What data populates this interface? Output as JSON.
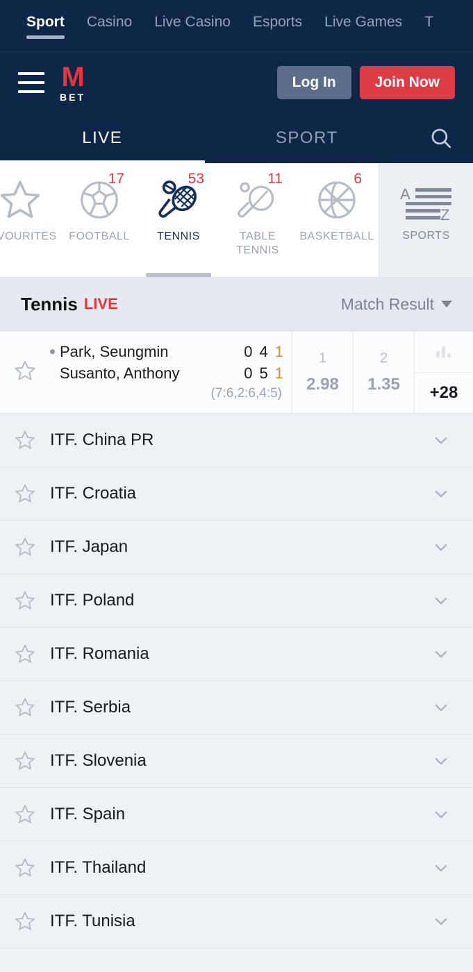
{
  "topbar": {
    "tabs": [
      {
        "label": "Sport",
        "active": true
      },
      {
        "label": "Casino",
        "active": false
      },
      {
        "label": "Live Casino",
        "active": false
      },
      {
        "label": "Esports",
        "active": false
      },
      {
        "label": "Live Games",
        "active": false
      },
      {
        "label": "T",
        "active": false
      }
    ]
  },
  "header": {
    "menu_icon": "hamburger-icon",
    "logo_mark": "M",
    "logo_word": "BET",
    "login_label": "Log In",
    "join_label": "Join Now"
  },
  "switchbar": {
    "live_label": "LIVE",
    "sport_label": "SPORT",
    "search_icon": "search-icon"
  },
  "sports": {
    "items": [
      {
        "label": "FAVOURITES",
        "icon": "star-icon",
        "badge": "",
        "active": false
      },
      {
        "label": "FOOTBALL",
        "icon": "football-icon",
        "badge": "17",
        "active": false
      },
      {
        "label": "TENNIS",
        "icon": "tennis-icon",
        "badge": "53",
        "active": true
      },
      {
        "label": "TABLE TENNIS",
        "icon": "table-tennis-icon",
        "badge": "11",
        "active": false
      },
      {
        "label": "BASKETBALL",
        "icon": "basketball-icon",
        "badge": "6",
        "active": false
      }
    ],
    "az_label": "SPORTS",
    "az_icon": "a-z-list-icon"
  },
  "section": {
    "title": "Tennis",
    "live_label": "LIVE",
    "filter_label": "Match Result"
  },
  "match": {
    "star_icon": "star-icon",
    "players": [
      {
        "name": "Park, Seungmin",
        "serving": true,
        "scores": [
          "0",
          "4"
        ],
        "games": "1"
      },
      {
        "name": "Susanto, Anthony",
        "serving": false,
        "scores": [
          "0",
          "5"
        ],
        "games": "1"
      }
    ],
    "set_scores": "(7:6,2:6,4:5)",
    "odds": [
      {
        "label": "1",
        "value": "2.98"
      },
      {
        "label": "2",
        "value": "1.35"
      }
    ],
    "stats_icon": "bar-chart-icon",
    "more_markets": "+28"
  },
  "leagues": [
    {
      "name": "ITF. China PR"
    },
    {
      "name": "ITF. Croatia"
    },
    {
      "name": "ITF. Japan"
    },
    {
      "name": "ITF. Poland"
    },
    {
      "name": "ITF. Romania"
    },
    {
      "name": "ITF. Serbia"
    },
    {
      "name": "ITF. Slovenia"
    },
    {
      "name": "ITF. Spain"
    },
    {
      "name": "ITF. Thailand"
    },
    {
      "name": "ITF. Tunisia"
    }
  ],
  "colors": {
    "navy": "#0e2647",
    "brand_red": "#e8353b",
    "join_red": "#dc3c46",
    "login_slate": "#5b6e89",
    "serve_orange": "#e0892c",
    "page_bg": "#eef1f5"
  }
}
